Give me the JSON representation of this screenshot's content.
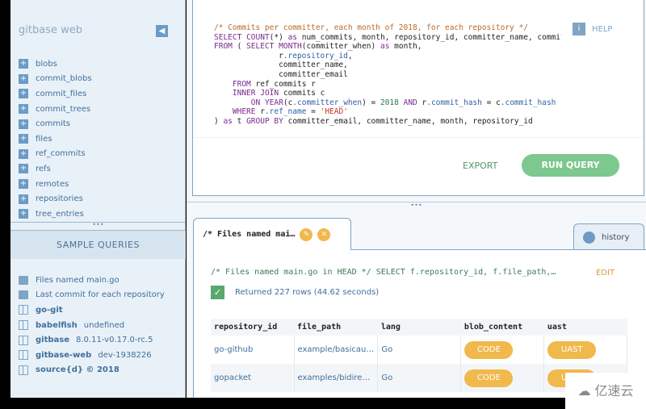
{
  "sidebar": {
    "brand": "gitbase web",
    "tables": [
      "blobs",
      "commit_blobs",
      "commit_files",
      "commit_trees",
      "commits",
      "files",
      "ref_commits",
      "refs",
      "remotes",
      "repositories",
      "tree_entries"
    ],
    "splitter": "•••",
    "sample_title": "SAMPLE QUERIES",
    "samples": [
      "Files named main.go",
      "Last commit for each repository"
    ],
    "versions": [
      {
        "name": "go-git",
        "value": ""
      },
      {
        "name": "babelfish",
        "value": "undefined"
      },
      {
        "name": "gitbase",
        "value": "8.0.11-v0.17.0-rc.5"
      },
      {
        "name": "gitbase-web",
        "value": "dev-1938226"
      },
      {
        "name": "source{d} © 2018",
        "value": ""
      }
    ]
  },
  "editor": {
    "help": "HELP",
    "export": "EXPORT",
    "run": "RUN QUERY",
    "lines": [
      "/* Commits per committer, each month of 2018, for each repository */",
      "SELECT COUNT(*) as num_commits, month, repository_id, committer_name, committer_email",
      "FROM ( SELECT MONTH(committer_when) as month,",
      "              r.repository_id,",
      "              committer_name,",
      "              committer_email",
      "    FROM ref_commits r",
      "    INNER JOIN commits c",
      "        ON YEAR(c.committer_when) = 2018 AND r.commit_hash = c.commit_hash",
      "    WHERE r.ref_name = 'HEAD'",
      ") as t GROUP BY committer_email, committer_name, month, repository_id"
    ]
  },
  "splitter": "•••",
  "results": {
    "tab_label": "/* Files named mai…",
    "history": "history",
    "query": "/* Files named main.go in HEAD */ SELECT f.repository_id, f.file_path,…",
    "edit": "EDIT",
    "status": "Returned 227 rows (44.62 seconds)",
    "columns": [
      "repository_id",
      "file_path",
      "lang",
      "blob_content",
      "uast"
    ],
    "rows": [
      {
        "repository_id": "go-github",
        "file_path": "example/basicau…",
        "lang": "Go",
        "blob_content": "CODE",
        "uast": "UAST"
      },
      {
        "repository_id": "gopacket",
        "file_path": "examples/bidire…",
        "lang": "Go",
        "blob_content": "CODE",
        "uast": "UAST"
      }
    ]
  },
  "watermark": "亿速云"
}
